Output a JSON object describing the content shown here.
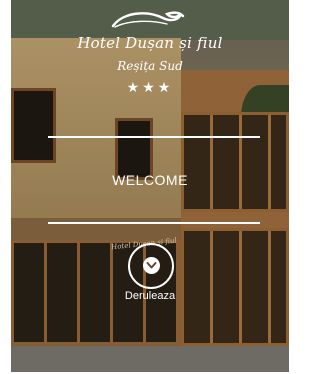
{
  "hero": {
    "hotel_name": "Hotel Dușan și fiul",
    "city": "Reșița Sud",
    "stars": "★★★",
    "welcome": "WELCOME",
    "scroll_label": "Deruleaza",
    "photo_sign_text": "Hotel Dușan și fiul"
  },
  "icons": {
    "ornament": "decorative-swirl-icon",
    "scroll": "chevron-down-icon"
  },
  "colors": {
    "overlay_text": "#ffffff",
    "wood_frame": "#a06d38"
  }
}
